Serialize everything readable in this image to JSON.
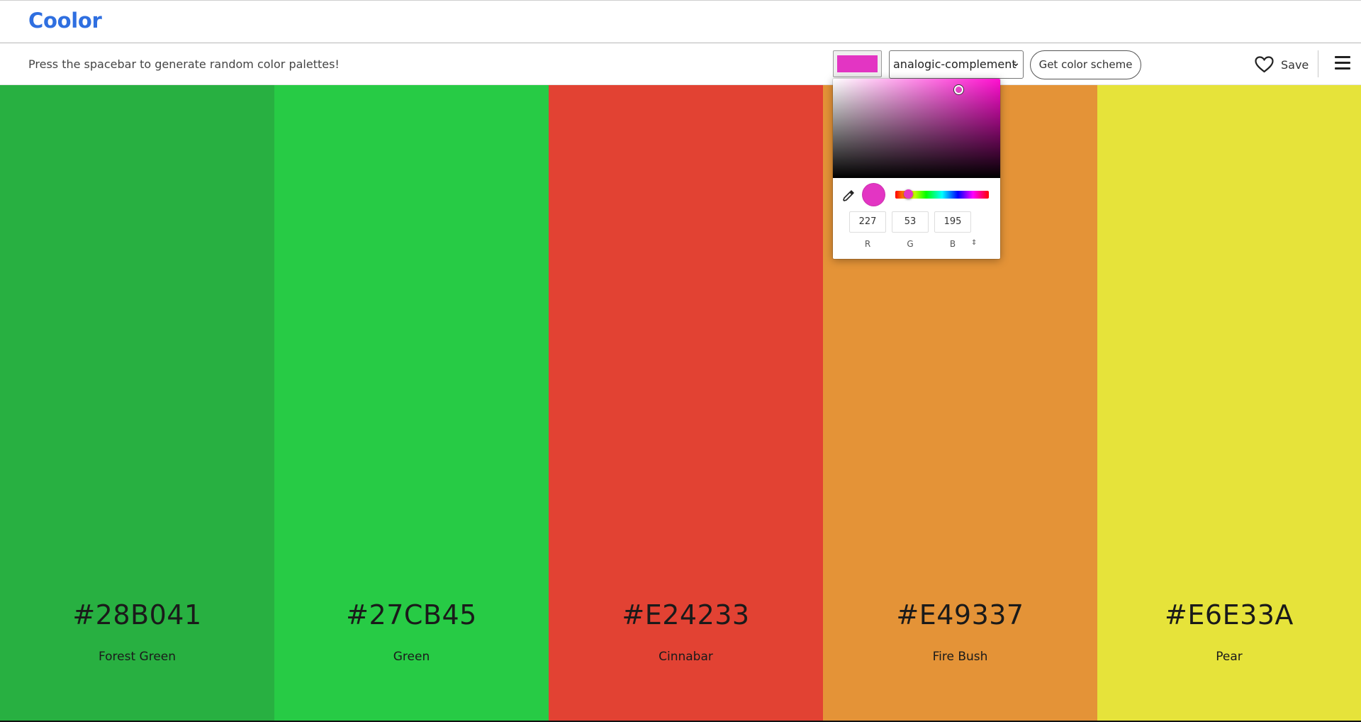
{
  "header": {
    "logo": "Coolor"
  },
  "toolbar": {
    "hint": "Press the spacebar to generate random color palettes!",
    "picked_color": "#e335c3",
    "scheme_mode": "analogic-complement",
    "get_scheme_label": "Get color scheme",
    "save_label": "Save"
  },
  "palette": [
    {
      "hex": "#28B041",
      "name": "Forest Green",
      "color": "#28b041"
    },
    {
      "hex": "#27CB45",
      "name": "Green",
      "color": "#27cb45"
    },
    {
      "hex": "#E24233",
      "name": "Cinnabar",
      "color": "#e24233"
    },
    {
      "hex": "#E49337",
      "name": "Fire Bush",
      "color": "#e49337"
    },
    {
      "hex": "#E6E33A",
      "name": "Pear",
      "color": "#e6e33a"
    }
  ],
  "picker": {
    "r": "227",
    "g": "53",
    "b": "195",
    "r_label": "R",
    "g_label": "G",
    "b_label": "B",
    "toggle_icon": "⇕"
  }
}
